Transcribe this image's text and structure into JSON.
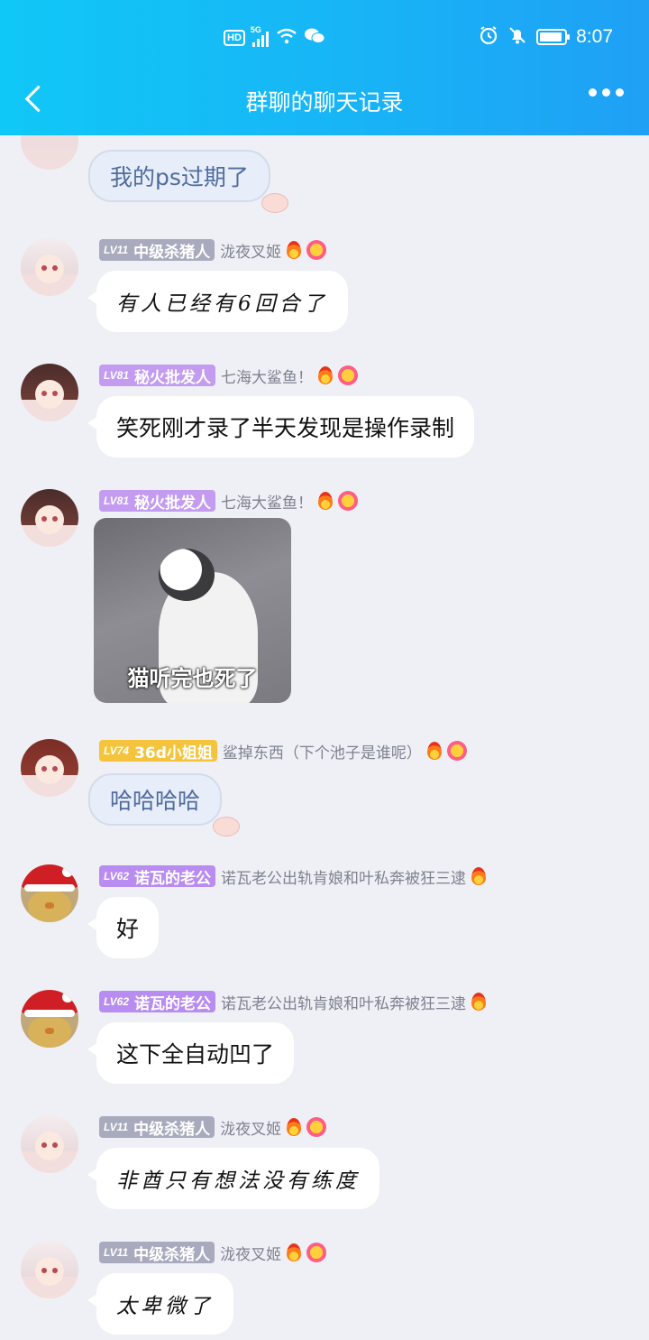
{
  "status_bar": {
    "hd": "HD",
    "network": "5G",
    "time": "8:07",
    "battery_level_pct": 90
  },
  "header": {
    "title": "群聊的聊天记录"
  },
  "messages": [
    {
      "level": "",
      "title": "",
      "nickname": "",
      "text": "我的ps过期了",
      "style": "cute-bubble"
    },
    {
      "level": "LV11",
      "title": "中级杀猪人",
      "nickname": "泷夜叉姬",
      "text": "有人已经有6回合了",
      "style": "handwriting"
    },
    {
      "level": "LV81",
      "title": "秘火批发人",
      "nickname": "七海大鲨鱼！",
      "text": "笑死刚才录了半天发现是操作录制",
      "style": "plain"
    },
    {
      "level": "LV81",
      "title": "秘火批发人",
      "nickname": "七海大鲨鱼！",
      "image_caption": "猫听完也死了",
      "style": "image"
    },
    {
      "level": "LV74",
      "title": "36d小姐姐",
      "nickname": "鲨掉东西（下个池子是谁呢）",
      "text": "哈哈哈哈",
      "style": "cute-bubble"
    },
    {
      "level": "LV62",
      "title": "诺瓦的老公",
      "nickname": "诺瓦老公出轨肯娘和叶私奔被狂三逮",
      "text": "好",
      "style": "plain"
    },
    {
      "level": "LV62",
      "title": "诺瓦的老公",
      "nickname": "诺瓦老公出轨肯娘和叶私奔被狂三逮",
      "text": "这下全自动凹了",
      "style": "plain"
    },
    {
      "level": "LV11",
      "title": "中级杀猪人",
      "nickname": "泷夜叉姬",
      "text": "非酋只有想法没有练度",
      "style": "handwriting"
    },
    {
      "level": "LV11",
      "title": "中级杀猪人",
      "nickname": "泷夜叉姬",
      "text": "太卑微了",
      "style": "handwriting"
    }
  ],
  "icons": {
    "wifi": "wifi-icon",
    "wechat": "wechat-icon",
    "alarm": "alarm-icon",
    "bell_off": "bell-off-icon",
    "battery": "battery-icon",
    "back": "back-arrow-icon",
    "more": "more-icon",
    "fire": "fire-badge-icon",
    "smile": "smile-badge-icon"
  },
  "colors": {
    "header_gradient_start": "#10c8f7",
    "header_gradient_end": "#1fa0f5",
    "chat_background": "#eef0f5",
    "level_gray": "#a7abbd",
    "level_purple": "#c39cf2",
    "level_gold": "#f5c43c"
  }
}
